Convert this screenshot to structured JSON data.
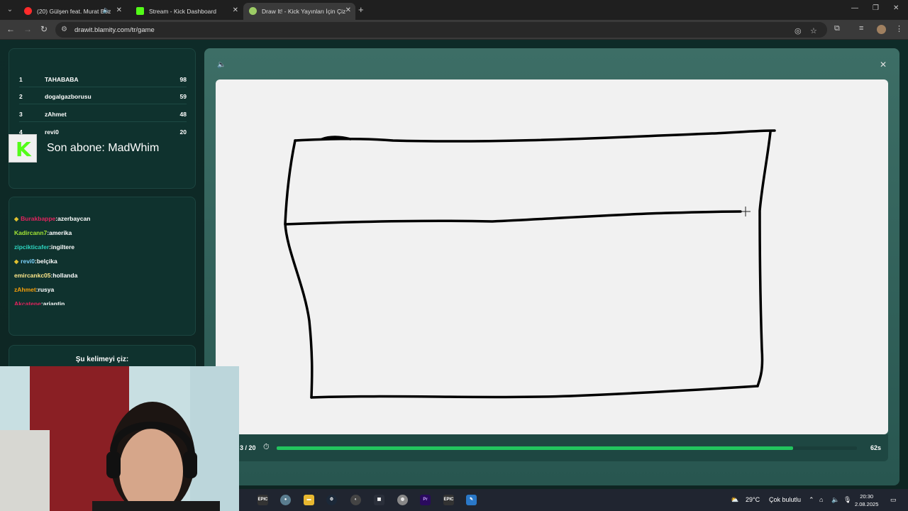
{
  "browser": {
    "tabs": [
      {
        "title": "(20) Gülşen feat. Murat Boz",
        "active": false
      },
      {
        "title": "Stream - Kick Dashboard",
        "active": false
      },
      {
        "title": "Draw It! - Kick Yayınları İçin Çiz",
        "active": true
      }
    ],
    "url": "drawit.blamity.com/tr/game"
  },
  "leaderboard": [
    {
      "rank": "1",
      "name": "TAHABABA",
      "score": "98"
    },
    {
      "rank": "2",
      "name": "dogalgazborusu",
      "score": "59"
    },
    {
      "rank": "3",
      "name": "zAhmet",
      "score": "48"
    },
    {
      "rank": "4",
      "name": "revi0",
      "score": "20"
    }
  ],
  "subscriber_overlay": {
    "text": "Son abone: MadWhim"
  },
  "chat": [
    {
      "badge": true,
      "user": "Burakbappe",
      "color": "#e0245e",
      "text": ":azerbaycan"
    },
    {
      "badge": false,
      "user": "Kadircann7",
      "color": "#a3e635",
      "text": ":amerika"
    },
    {
      "badge": false,
      "user": "zipcikticafer",
      "color": "#2dd4bf",
      "text": ":ingiltere"
    },
    {
      "badge": true,
      "user": "revi0",
      "color": "#7dd3fc",
      "text": ":belçika"
    },
    {
      "badge": false,
      "user": "emircankc05",
      "color": "#fde68a",
      "text": ":hollanda"
    },
    {
      "badge": false,
      "user": "zAhmet",
      "color": "#f59e0b",
      "text": ":rusya"
    },
    {
      "badge": false,
      "user": "Akcatepe",
      "color": "#e0245e",
      "text": ":arjantin"
    }
  ],
  "word_panel": {
    "label": "Şu kelimeyi çiz:"
  },
  "game": {
    "round": "3 / 20",
    "time_left": "62s",
    "timer_progress": 0.89
  },
  "taskbar": {
    "weather_temp": "29°C",
    "weather_text": "Çok bulutlu",
    "time": "20:30",
    "date": "2.08.2025"
  }
}
